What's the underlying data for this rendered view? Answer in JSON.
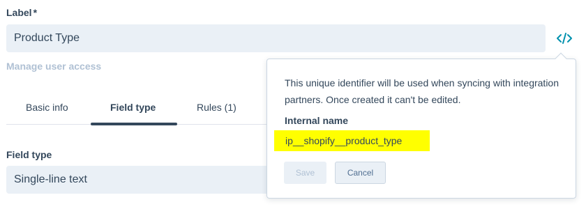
{
  "label_field": {
    "label": "Label",
    "required_marker": "*",
    "value": "Product Type"
  },
  "code_button": {
    "icon": "code-icon",
    "color": "#0091ae"
  },
  "manage_access": {
    "text": "Manage user access"
  },
  "tabs": [
    {
      "label": "Basic info",
      "active": false
    },
    {
      "label": "Field type",
      "active": true
    },
    {
      "label": "Rules (1)",
      "active": false
    }
  ],
  "field_type": {
    "label": "Field type",
    "value": "Single-line text"
  },
  "popover": {
    "description": "This unique identifier will be used when syncing with integration partners. Once created it can't be edited.",
    "internal_name_label": "Internal name",
    "internal_name_value": "ip__shopify__product_type",
    "highlight_color": "#ffff00",
    "save_label": "Save",
    "cancel_label": "Cancel"
  }
}
